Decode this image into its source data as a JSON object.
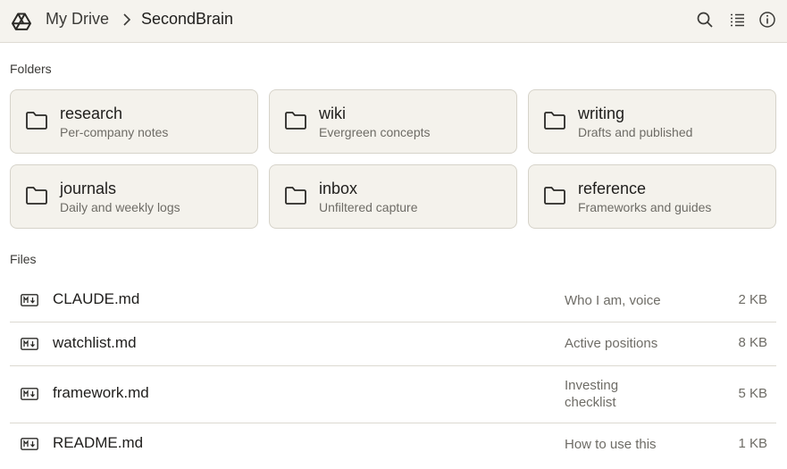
{
  "header": {
    "breadcrumb_root": "My Drive",
    "breadcrumb_current": "SecondBrain"
  },
  "sections": {
    "folders_label": "Folders",
    "files_label": "Files"
  },
  "folders": [
    {
      "name": "research",
      "desc": "Per-company notes"
    },
    {
      "name": "wiki",
      "desc": "Evergreen concepts"
    },
    {
      "name": "writing",
      "desc": "Drafts and published"
    },
    {
      "name": "journals",
      "desc": "Daily and weekly logs"
    },
    {
      "name": "inbox",
      "desc": "Unfiltered capture"
    },
    {
      "name": "reference",
      "desc": "Frameworks and guides"
    }
  ],
  "files": [
    {
      "name": "CLAUDE.md",
      "desc": "Who I am, voice",
      "size": "2 KB"
    },
    {
      "name": "watchlist.md",
      "desc": "Active positions",
      "size": "8 KB"
    },
    {
      "name": "framework.md",
      "desc": "Investing checklist",
      "size": "5 KB"
    },
    {
      "name": "README.md",
      "desc": "How to use this",
      "size": "1 KB"
    }
  ],
  "icons": {
    "logo": "drive-logo-icon",
    "search": "search-icon",
    "list_view": "list-view-icon",
    "info": "info-icon",
    "folder": "folder-icon",
    "markdown": "markdown-file-icon"
  },
  "colors": {
    "topbar_bg": "#f5f3ee",
    "card_bg": "#f4f2ec",
    "card_border": "#d6d3ca",
    "text_primary": "#1f1e1c",
    "text_secondary": "#6e6c66"
  }
}
